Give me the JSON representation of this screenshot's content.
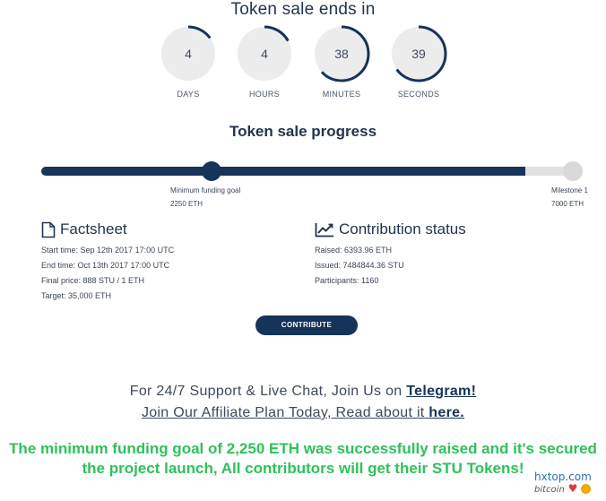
{
  "countdown": {
    "title": "Token sale ends in",
    "units": [
      {
        "value": "4",
        "label": "DAYS",
        "fraction": 0.15
      },
      {
        "value": "4",
        "label": "HOURS",
        "fraction": 0.17
      },
      {
        "value": "38",
        "label": "MINUTES",
        "fraction": 0.63
      },
      {
        "value": "39",
        "label": "SECONDS",
        "fraction": 0.65
      }
    ]
  },
  "progress": {
    "title": "Token sale progress",
    "fill_fraction": 0.9,
    "goal_marker": {
      "label": "Minimum funding goal",
      "value": "2250 ETH"
    },
    "milestone_marker": {
      "label": "Milestone 1",
      "value": "7000 ETH"
    }
  },
  "factsheet": {
    "title": "Factsheet",
    "icon": "document-icon",
    "lines": [
      "Start time: Sep 12th 2017 17:00 UTC",
      "End time: Oct 13th 2017 17:00 UTC",
      "Final price: 888 STU / 1 ETH",
      "Target: 35,000 ETH"
    ]
  },
  "contribution": {
    "title": "Contribution status",
    "icon": "line-chart-icon",
    "lines": [
      "Raised: 6393.96 ETH",
      "Issued: 7484844.36 STU",
      "Participants: 1160"
    ]
  },
  "contribute_button": "CONTRIBUTE",
  "support": {
    "line1_text": "For 24/7 Support & Live Chat, Join Us on ",
    "line1_link": "Telegram!",
    "line2_text": "Join Our Affiliate Plan Today, Read about it ",
    "line2_link": "here."
  },
  "announcement": "The minimum funding goal of 2,250 ETH was successfully raised and it's secured the project launch, All contributors will get their STU Tokens!",
  "watermark": {
    "site": "hxtop.com",
    "sub": "bitcoin"
  },
  "colors": {
    "primary": "#16335a",
    "track": "#e1e1e1",
    "success": "#2ec25a",
    "circle_bg": "#ececec"
  }
}
